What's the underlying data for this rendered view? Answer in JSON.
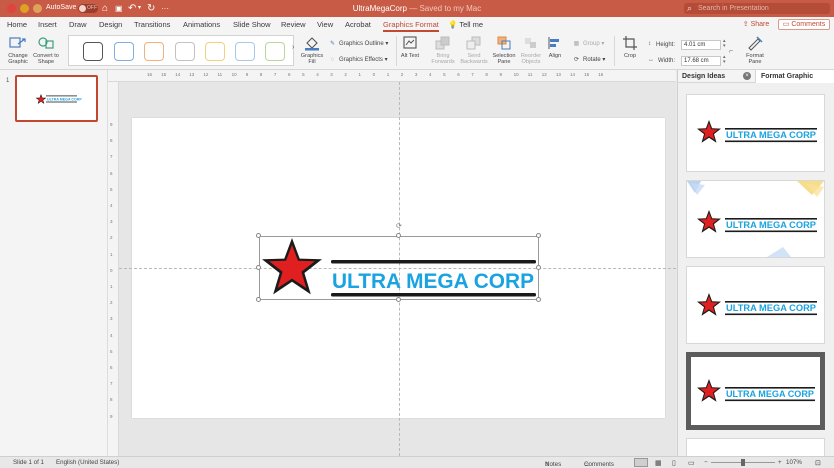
{
  "titlebar": {
    "autosave_label": "AutoSave",
    "autosave_state": "OFF",
    "doc_name": "UltraMegaCorp",
    "doc_status": "— Saved to my Mac",
    "search_placeholder": "Search in Presentation"
  },
  "tabs": [
    {
      "label": "Home"
    },
    {
      "label": "Insert"
    },
    {
      "label": "Draw"
    },
    {
      "label": "Design"
    },
    {
      "label": "Transitions"
    },
    {
      "label": "Animations"
    },
    {
      "label": "Slide Show"
    },
    {
      "label": "Review"
    },
    {
      "label": "View"
    },
    {
      "label": "Acrobat"
    },
    {
      "label": "Graphics Format"
    }
  ],
  "tell_me": "Tell me",
  "share_label": "Share",
  "comments_label": "Comments",
  "ribbon": {
    "change_graphic": "Change Graphic",
    "convert_to_shape": "Convert to Shape",
    "graphics_fill": "Graphics Fill",
    "graphics_outline": "Graphics Outline",
    "graphics_effects": "Graphics Effects",
    "alt_text": "Alt Text",
    "bring_forward": "Bring Forwards",
    "send_backward": "Send Backwards",
    "selection_pane": "Selection Pane",
    "reorder_objects": "Reorder Objects",
    "align": "Align",
    "group": "Group",
    "rotate": "Rotate",
    "crop": "Crop",
    "height_label": "Height:",
    "height_value": "4.01 cm",
    "width_label": "Width:",
    "width_value": "17.68 cm",
    "format_pane": "Format Pane"
  },
  "ruler_top": [
    "16",
    "15",
    "14",
    "13",
    "12",
    "11",
    "10",
    "9",
    "8",
    "7",
    "6",
    "5",
    "4",
    "3",
    "2",
    "1",
    "0",
    "1",
    "2",
    "3",
    "4",
    "5",
    "6",
    "7",
    "8",
    "9",
    "10",
    "11",
    "12",
    "13",
    "14",
    "15",
    "16"
  ],
  "ruler_left": [
    "9",
    "8",
    "7",
    "6",
    "5",
    "4",
    "3",
    "2",
    "1",
    "0",
    "1",
    "2",
    "3",
    "4",
    "5",
    "6",
    "7",
    "8",
    "9"
  ],
  "slides": [
    {
      "number": "1",
      "logo_text": "ULTRA MEGA CORP"
    }
  ],
  "logo_text": "ULTRA MEGA CORP",
  "right_pane": {
    "design_ideas": "Design Ideas",
    "format_graphic": "Format Graphic",
    "ideas_logo_text": "ULTRA MEGA CORP"
  },
  "status": {
    "slide_info": "Slide 1 of 1",
    "language": "English (United States)",
    "notes": "Notes",
    "comments": "Comments",
    "zoom": "107%"
  },
  "colors": {
    "accent": "#c85b45",
    "logo_blue": "#1aa3e0",
    "logo_red": "#e02020"
  }
}
